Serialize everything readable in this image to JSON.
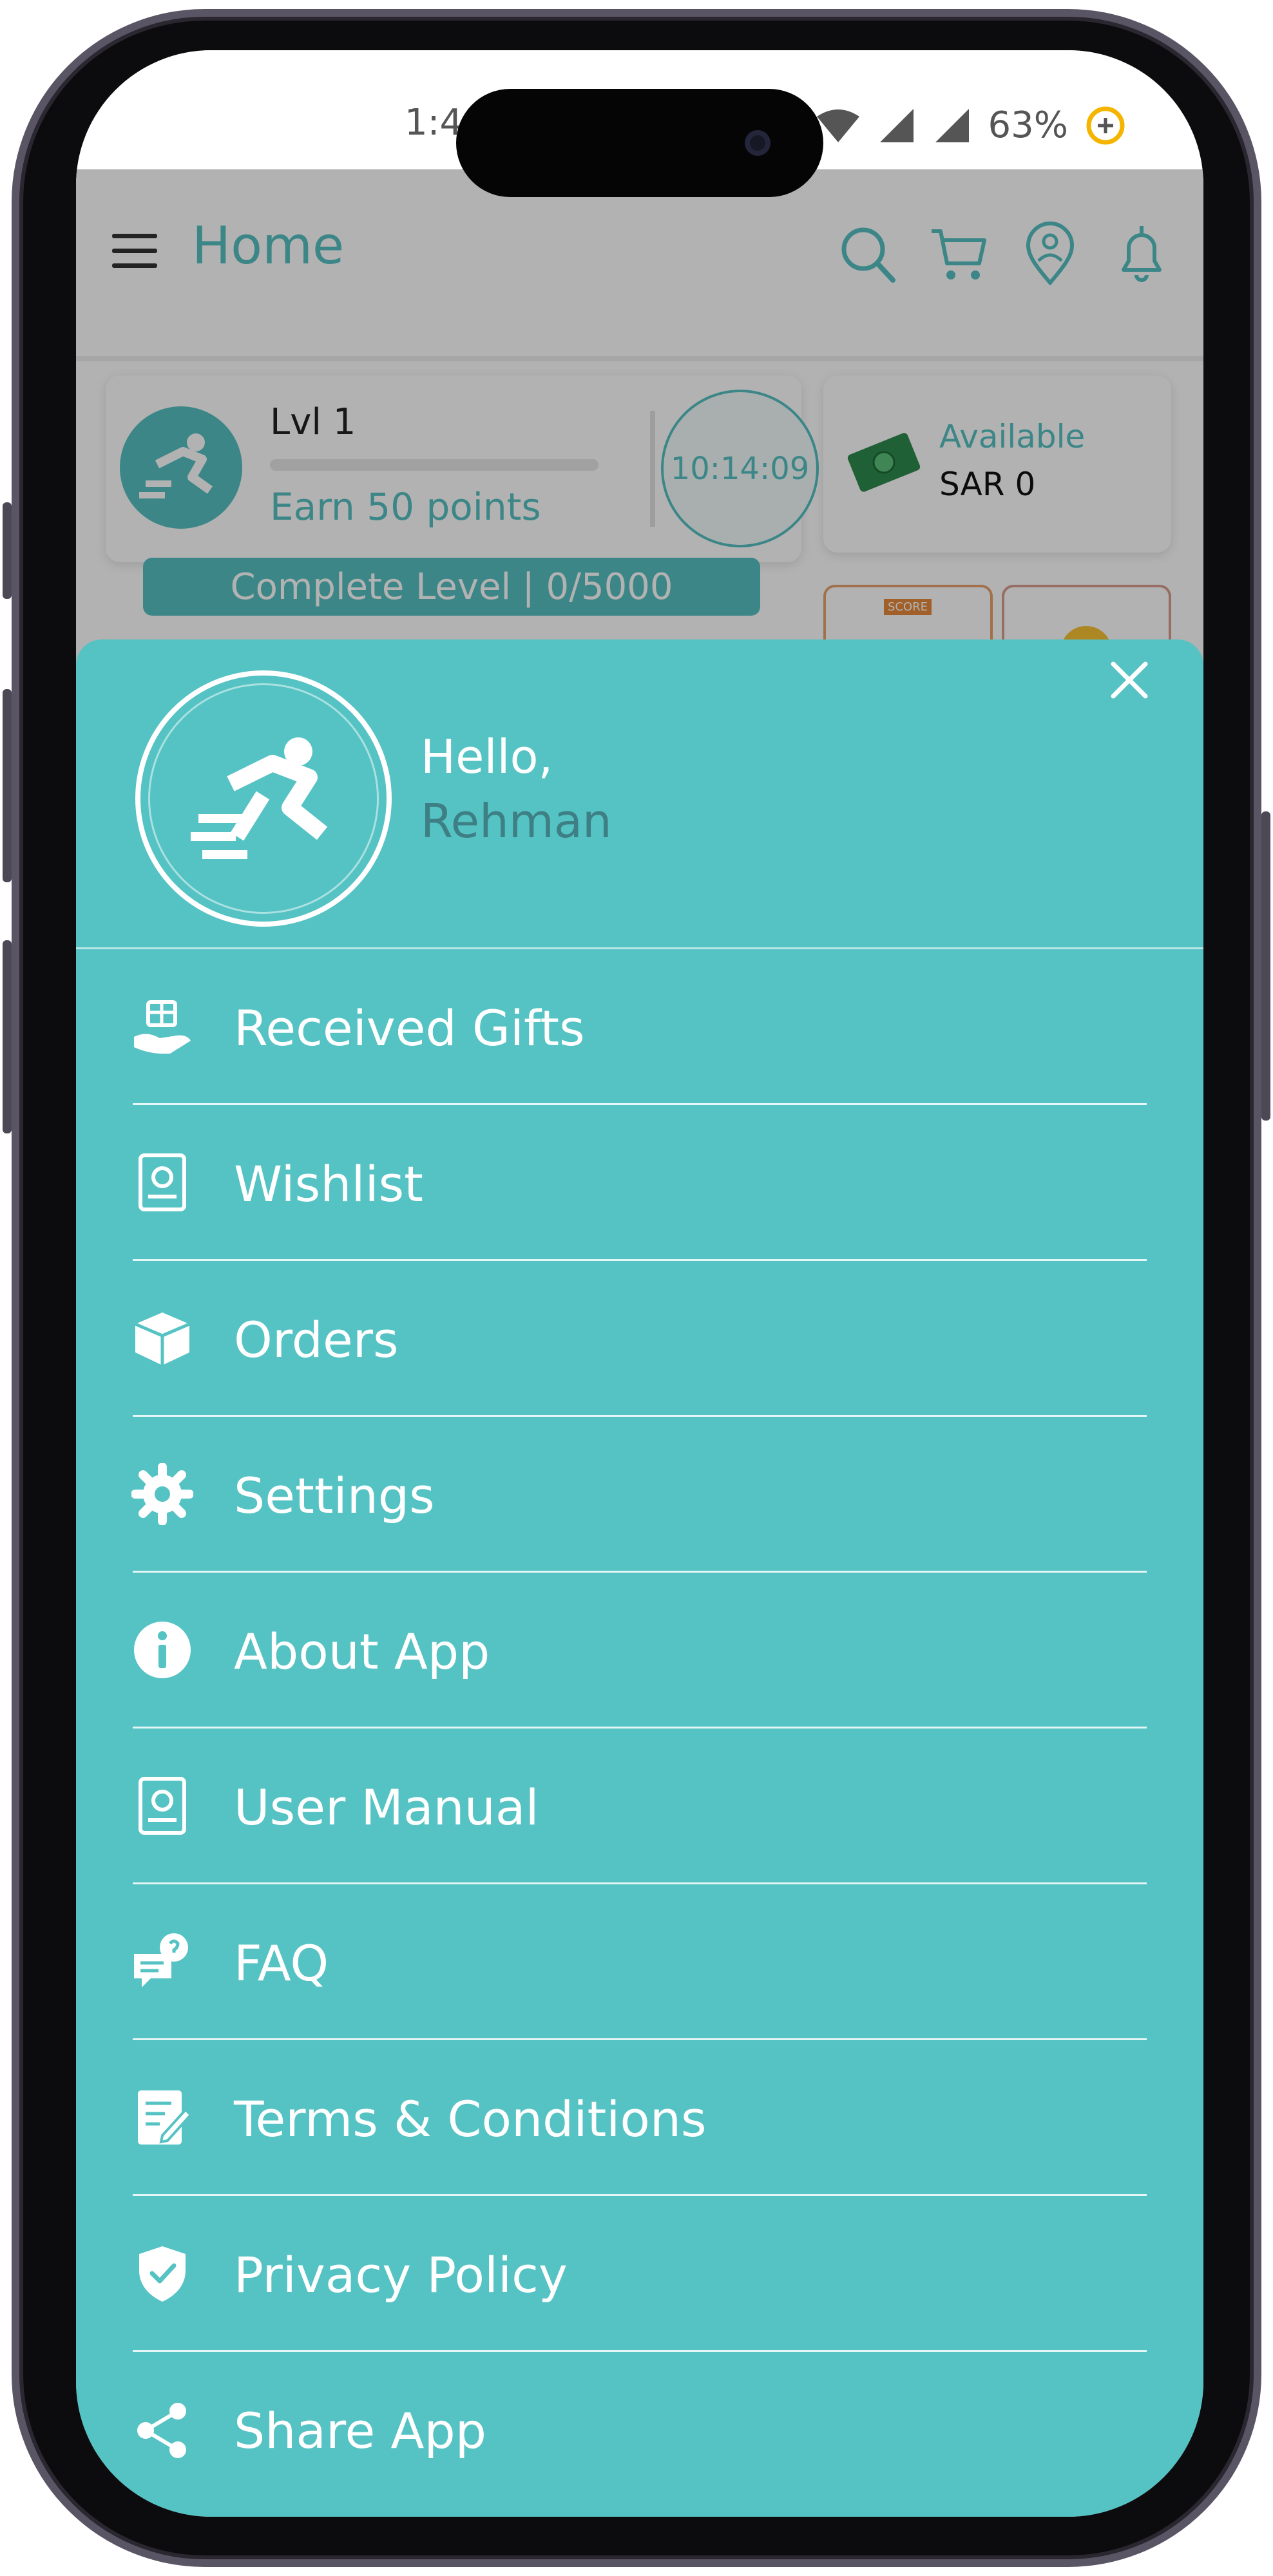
{
  "status_bar": {
    "time": "1:4",
    "battery_percent": "63%"
  },
  "app_bar": {
    "title": "Home",
    "icons": [
      "menu-icon",
      "search-icon",
      "cart-icon",
      "location-icon",
      "bell-icon"
    ]
  },
  "home": {
    "level_label": "Lvl 1",
    "earn_text": "Earn 50 points",
    "timer": "10:14:09",
    "wallet_label": "Available",
    "wallet_value": "SAR 0",
    "complete_level": "Complete Level  |  0/5000",
    "mini_card_text": "SCORE"
  },
  "drawer": {
    "greeting": "Hello,",
    "user_name": "Rehman",
    "items": [
      {
        "label": "Received Gifts",
        "icon": "gift-icon"
      },
      {
        "label": "Wishlist",
        "icon": "wishlist-icon"
      },
      {
        "label": "Orders",
        "icon": "box-icon"
      },
      {
        "label": "Settings",
        "icon": "gear-icon"
      },
      {
        "label": "About App",
        "icon": "info-icon"
      },
      {
        "label": "User Manual",
        "icon": "manual-icon"
      },
      {
        "label": "FAQ",
        "icon": "faq-icon"
      },
      {
        "label": "Terms & Conditions",
        "icon": "terms-icon"
      },
      {
        "label": "Privacy Policy",
        "icon": "shield-icon"
      },
      {
        "label": "Share App",
        "icon": "share-icon"
      }
    ]
  },
  "colors": {
    "accent": "#56c1c2",
    "drawer_bg": "#55c2c3",
    "username": "#3d7f84"
  }
}
